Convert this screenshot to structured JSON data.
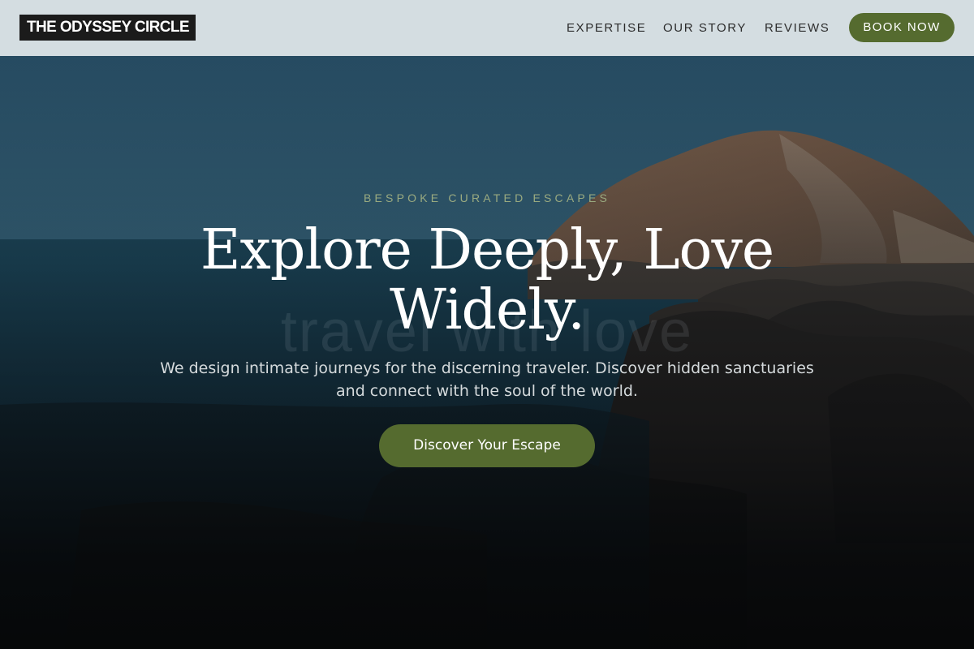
{
  "header": {
    "logo": "THE ODYSSEY CIRCLE",
    "nav": [
      {
        "label": "EXPERTISE"
      },
      {
        "label": "OUR STORY"
      },
      {
        "label": "REVIEWS"
      }
    ],
    "cta_label": "BOOK NOW"
  },
  "hero": {
    "eyebrow": "BESPOKE CURATED ESCAPES",
    "watermark": "travel with love",
    "headline": "Explore Deeply, Love Widely.",
    "subtext": "We design intimate journeys for the discerning traveler. Discover hidden sanctuaries and connect with the soul of the world.",
    "cta_label": "Discover Your Escape"
  },
  "colors": {
    "header_bg": "#d4dde1",
    "accent_green": "#556b2f",
    "logo_bg": "#1b1b1b",
    "eyebrow_text": "#9aaa80"
  }
}
